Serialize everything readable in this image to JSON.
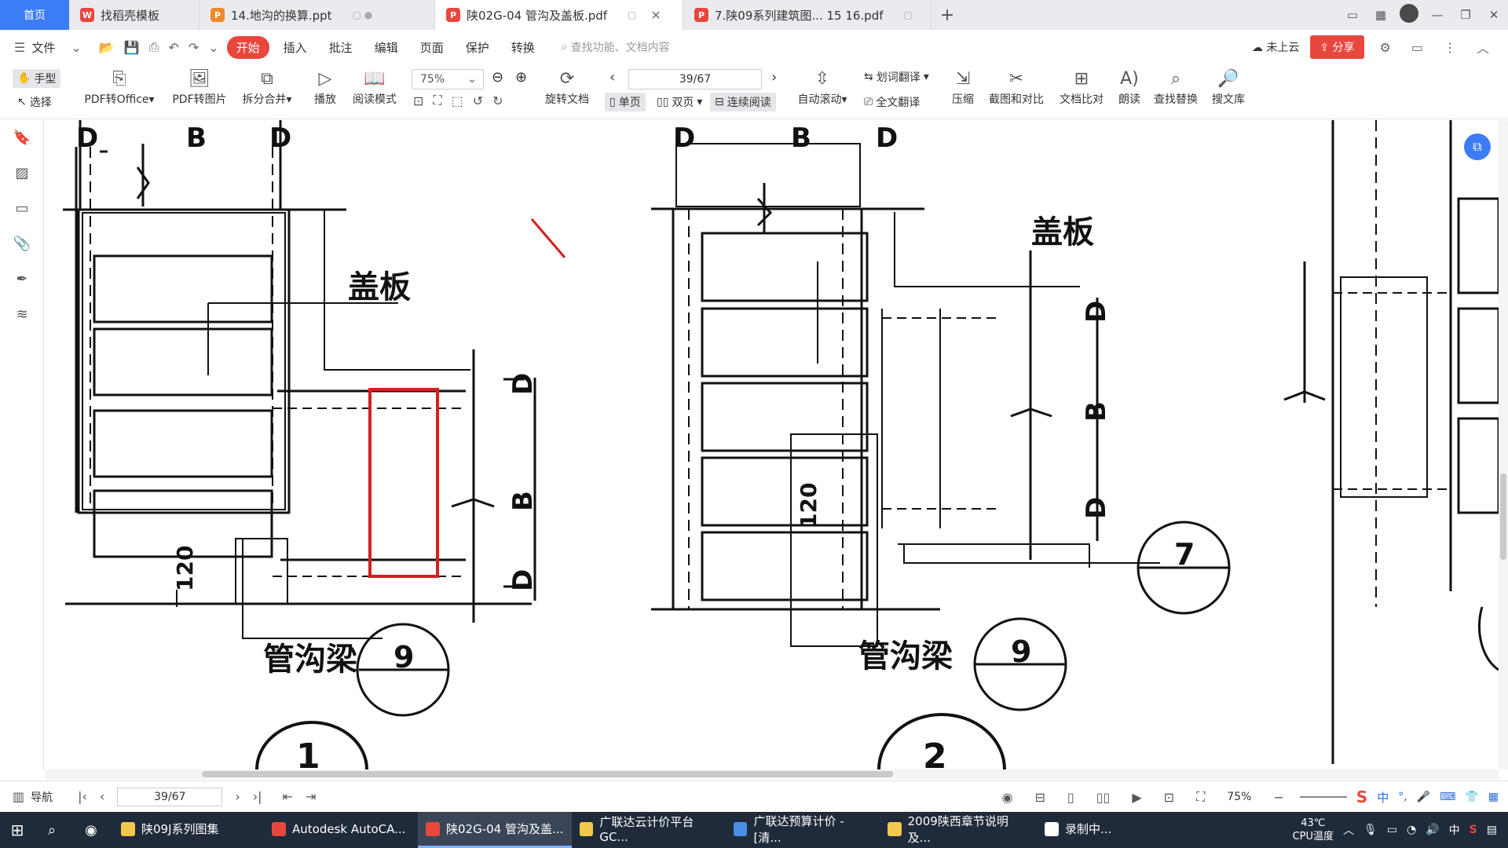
{
  "tabs": {
    "home": "首页",
    "items": [
      {
        "label": "找稻壳模板",
        "icon_color": "#e8473d"
      },
      {
        "label": "14.地沟的换算.ppt",
        "icon_color": "#f2892b"
      },
      {
        "label": "陕02G-04 管沟及盖板.pdf",
        "icon_color": "#e8473d"
      },
      {
        "label": "7.陕09系列建筑图... 15 16.pdf",
        "icon_color": "#e8473d"
      }
    ]
  },
  "menu": {
    "file": "文件",
    "items": [
      "开始",
      "插入",
      "批注",
      "编辑",
      "页面",
      "保护",
      "转换"
    ],
    "search_placeholder": "查找功能、文档内容",
    "cloud": "未上云",
    "share": "分享"
  },
  "ribbon": {
    "hand": "手型",
    "select": "选择",
    "pdf_to_office": "PDF转Office",
    "pdf_to_image": "PDF转图片",
    "split_merge": "拆分合并",
    "play": "播放",
    "read_mode": "阅读模式",
    "zoom": "75%",
    "rotate": "旋转文档",
    "page_value": "39/67",
    "single": "单页",
    "double": "双页",
    "continuous": "连续阅读",
    "auto_scroll": "自动滚动",
    "word_translate": "划词翻译",
    "full_translate": "全文翻译",
    "compress": "压缩",
    "screenshot_compare": "截图和对比",
    "doc_compare": "文档比对",
    "read_aloud": "朗读",
    "find_replace": "查找替换",
    "search_library": "搜文库"
  },
  "drawing": {
    "left": {
      "d_top_left": "D",
      "b_top": "B",
      "d_top_right": "D",
      "cover_plate": "盖板",
      "d_right_top": "D",
      "b_right": "B",
      "d_right_bottom": "D",
      "dim_120": "120",
      "beam": "管沟梁",
      "circle_num": "9",
      "big_circle_num": "1"
    },
    "middle": {
      "d_top_left": "D",
      "b_top": "B",
      "d_top_right": "D",
      "cover_plate": "盖板",
      "d_right_top": "D",
      "b_right": "B",
      "d_right_bottom": "D",
      "dim_120": "120",
      "beam": "管沟梁",
      "circle_num": "9",
      "circle_num_7": "7",
      "big_circle_num": "2"
    }
  },
  "statusbar": {
    "nav": "导航",
    "page": "39/67",
    "zoom": "75%"
  },
  "taskbar": {
    "apps": [
      {
        "label": "陕09J系列图集",
        "color": "#f2c94c"
      },
      {
        "label": "Autodesk AutoCA...",
        "color": "#e8473d"
      },
      {
        "label": "陕02G-04 管沟及盖...",
        "color": "#e8473d"
      },
      {
        "label": "广联达云计价平台GC...",
        "color": "#f2c94c"
      },
      {
        "label": "广联达预算计价 - [清...",
        "color": "#4a8fe7"
      },
      {
        "label": "2009陕西章节说明及...",
        "color": "#f2c94c"
      },
      {
        "label": "录制中...",
        "color": "#ffffff"
      }
    ],
    "temp": "43℃",
    "temp_label": "CPU温度",
    "ime": "中"
  }
}
